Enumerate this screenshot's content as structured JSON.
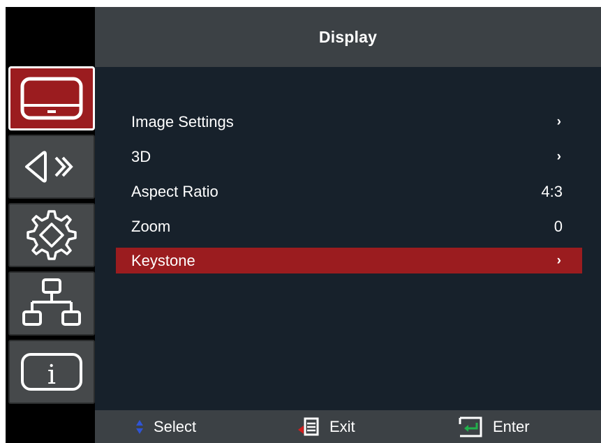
{
  "header": {
    "title": "Display"
  },
  "sidebar": {
    "items": [
      {
        "icon": "display-icon",
        "active": true
      },
      {
        "icon": "audio-icon",
        "active": false
      },
      {
        "icon": "setup-gear-icon",
        "active": false
      },
      {
        "icon": "network-icon",
        "active": false
      },
      {
        "icon": "info-icon",
        "active": false
      }
    ],
    "info_glyph": "i"
  },
  "menu": {
    "items": [
      {
        "label": "Image Settings",
        "value": "",
        "submenu": true,
        "selected": false
      },
      {
        "label": "3D",
        "value": "",
        "submenu": true,
        "selected": false
      },
      {
        "label": "Aspect Ratio",
        "value": "4:3",
        "submenu": false,
        "selected": false
      },
      {
        "label": "Zoom",
        "value": "0",
        "submenu": false,
        "selected": false
      },
      {
        "label": "Keystone",
        "value": "",
        "submenu": true,
        "selected": true
      }
    ],
    "submenu_glyph": "›"
  },
  "footer": {
    "select_label": "Select",
    "exit_label": "Exit",
    "enter_label": "Enter"
  },
  "colors": {
    "accent": "#9b1c1f",
    "panel": "#17212b",
    "header": "#3c4145",
    "sidebar": "#46494b",
    "select_arrows": "#2f54d6",
    "exit_arrow": "#d11f1f",
    "enter_arrow": "#22b14c"
  }
}
